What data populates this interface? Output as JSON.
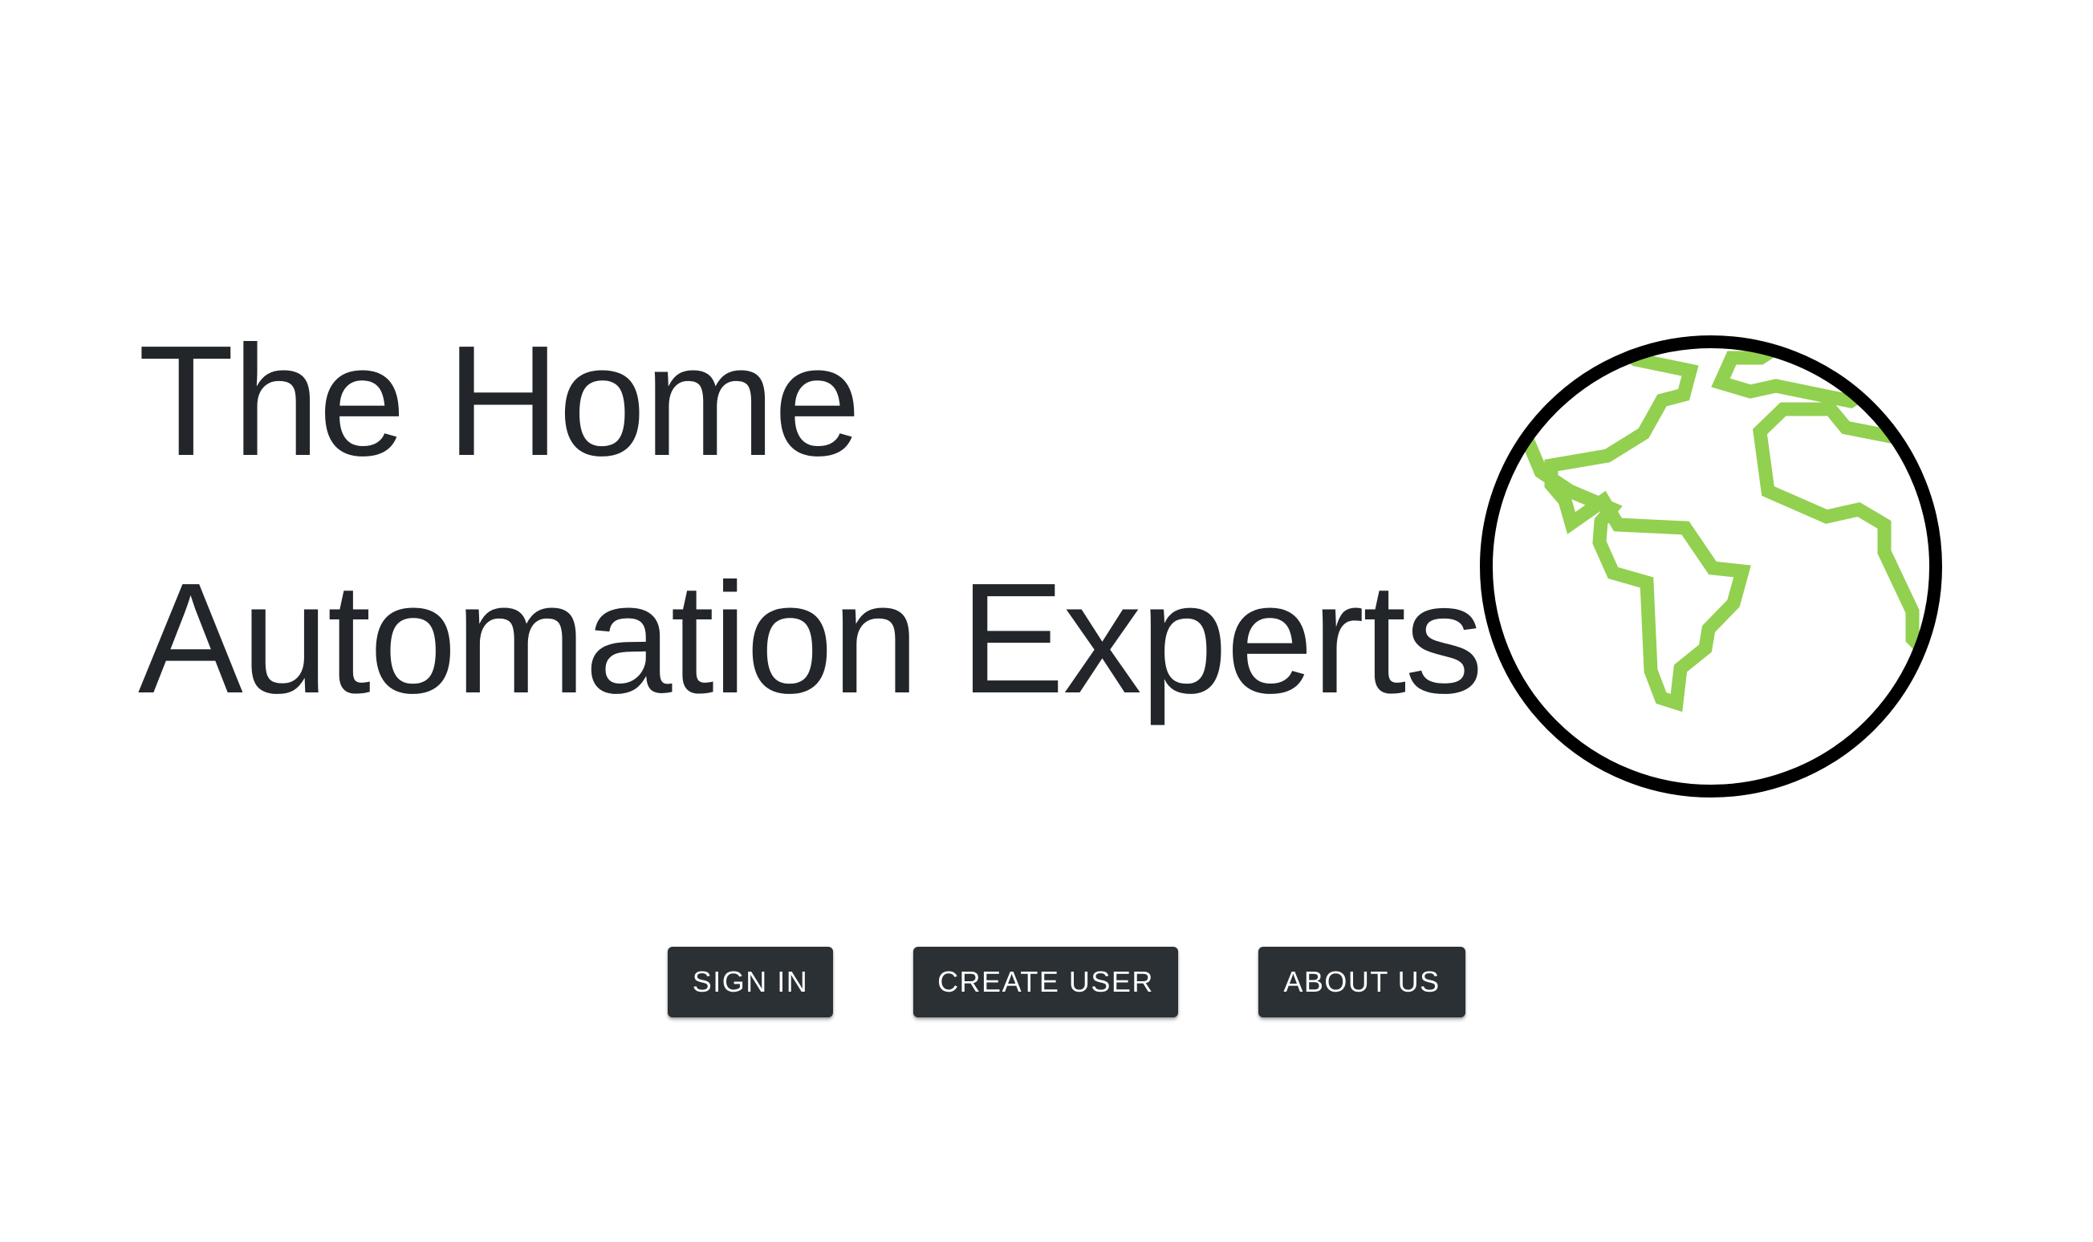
{
  "hero": {
    "title_line1": "The Home",
    "title_line2": "Automation Experts"
  },
  "globe": {
    "icon": "globe-icon",
    "outline_color": "#000000",
    "land_color": "#92d050"
  },
  "actions": {
    "sign_in": "SIGN IN",
    "create_user": "CREATE USER",
    "about_us": "ABOUT US"
  },
  "colors": {
    "button_bg": "#2b3034",
    "button_text": "#ffffff",
    "title_text": "#22262a"
  }
}
